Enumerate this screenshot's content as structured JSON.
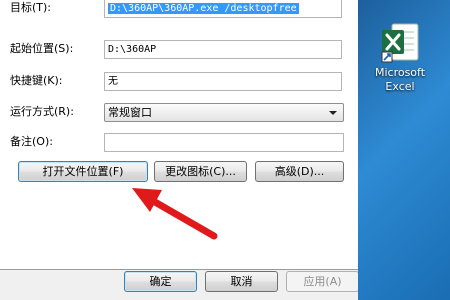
{
  "dialog": {
    "fields": {
      "target_label": "目标(T):",
      "target_value": "D:\\360AP\\360AP.exe /desktopfree",
      "start_label": "起始位置(S):",
      "start_value": "D:\\360AP",
      "shortcut_label": "快捷键(K):",
      "shortcut_value": "无",
      "run_label": "运行方式(R):",
      "run_value": "常规窗口",
      "comment_label": "备注(O):",
      "comment_value": ""
    },
    "buttons": {
      "open_location": "打开文件位置(F)",
      "change_icon": "更改图标(C)...",
      "advanced": "高级(D)..."
    },
    "footer": {
      "ok": "确定",
      "cancel": "取消",
      "apply": "应用(A)"
    }
  },
  "desktop": {
    "icon_name": "excel-icon",
    "icon_label_line1": "Microsoft",
    "icon_label_line2": "Excel",
    "accent": "#1d6f42"
  },
  "annotation": {
    "arrow_color": "#e0191b"
  }
}
